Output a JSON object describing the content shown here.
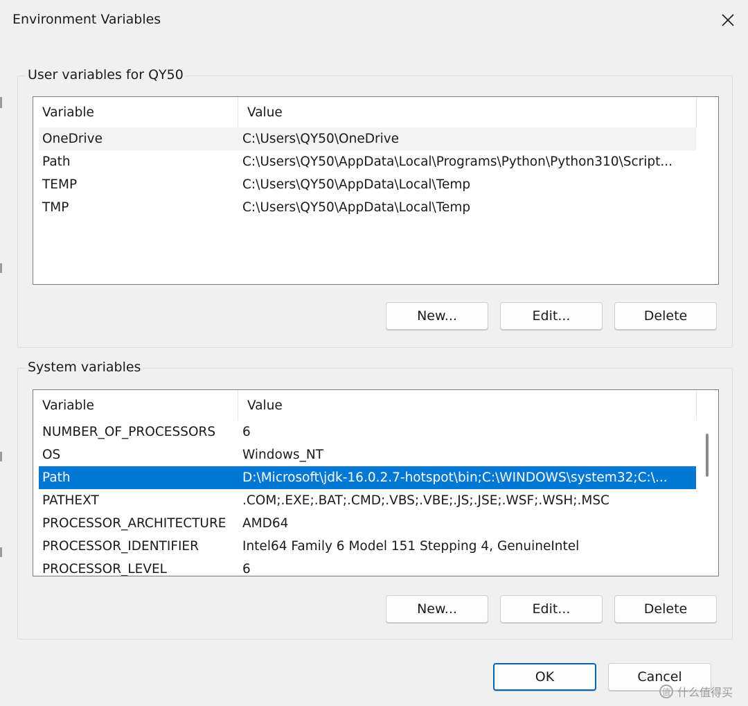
{
  "window": {
    "title": "Environment Variables"
  },
  "user_group": {
    "label": "User variables for QY50",
    "columns": [
      "Variable",
      "Value"
    ],
    "rows": [
      {
        "variable": "OneDrive",
        "value": "C:\\Users\\QY50\\OneDrive"
      },
      {
        "variable": "Path",
        "value": "C:\\Users\\QY50\\AppData\\Local\\Programs\\Python\\Python310\\Script..."
      },
      {
        "variable": "TEMP",
        "value": "C:\\Users\\QY50\\AppData\\Local\\Temp"
      },
      {
        "variable": "TMP",
        "value": "C:\\Users\\QY50\\AppData\\Local\\Temp"
      }
    ],
    "buttons": {
      "new": "New...",
      "edit": "Edit...",
      "delete": "Delete"
    }
  },
  "system_group": {
    "label": "System variables",
    "columns": [
      "Variable",
      "Value"
    ],
    "rows": [
      {
        "variable": "NUMBER_OF_PROCESSORS",
        "value": "6"
      },
      {
        "variable": "OS",
        "value": "Windows_NT"
      },
      {
        "variable": "Path",
        "value": "D:\\Microsoft\\jdk-16.0.2.7-hotspot\\bin;C:\\WINDOWS\\system32;C:\\..."
      },
      {
        "variable": "PATHEXT",
        "value": ".COM;.EXE;.BAT;.CMD;.VBS;.VBE;.JS;.JSE;.WSF;.WSH;.MSC"
      },
      {
        "variable": "PROCESSOR_ARCHITECTURE",
        "value": "AMD64"
      },
      {
        "variable": "PROCESSOR_IDENTIFIER",
        "value": "Intel64 Family 6 Model 151 Stepping 4, GenuineIntel"
      },
      {
        "variable": "PROCESSOR_LEVEL",
        "value": "6"
      }
    ],
    "buttons": {
      "new": "New...",
      "edit": "Edit...",
      "delete": "Delete"
    }
  },
  "footer": {
    "ok": "OK",
    "cancel": "Cancel"
  },
  "watermark": {
    "text": "什么值得买",
    "icon_glyph": "值"
  },
  "colors": {
    "selection": "#0078d4",
    "default_button_border": "#0067c0",
    "hover_row": "#f3f3f3"
  }
}
